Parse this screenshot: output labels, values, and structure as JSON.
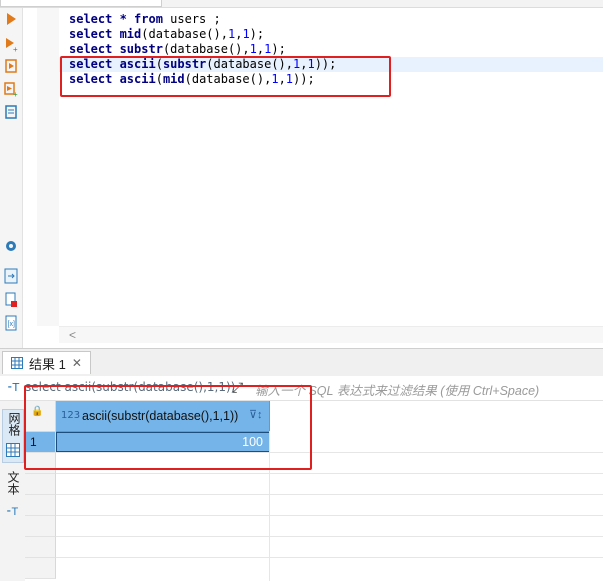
{
  "editor": {
    "lines": [
      {
        "parts": [
          {
            "t": "select * ",
            "c": "kw"
          },
          {
            "t": "from",
            "c": "kw"
          },
          {
            "t": " users ;",
            "c": ""
          }
        ]
      },
      {
        "parts": [
          {
            "t": "select ",
            "c": "kw"
          },
          {
            "t": "mid",
            "c": "kw"
          },
          {
            "t": "(database(),",
            "c": ""
          },
          {
            "t": "1",
            "c": "num"
          },
          {
            "t": ",",
            "c": ""
          },
          {
            "t": "1",
            "c": "num"
          },
          {
            "t": ");",
            "c": ""
          }
        ]
      },
      {
        "parts": [
          {
            "t": "select ",
            "c": "kw"
          },
          {
            "t": "substr",
            "c": "kw"
          },
          {
            "t": "(database(),",
            "c": ""
          },
          {
            "t": "1",
            "c": "num"
          },
          {
            "t": ",",
            "c": ""
          },
          {
            "t": "1",
            "c": "num"
          },
          {
            "t": ");",
            "c": ""
          }
        ]
      },
      {
        "parts": [
          {
            "t": "select ",
            "c": "kw"
          },
          {
            "t": "ascii",
            "c": "kw"
          },
          {
            "t": "(",
            "c": ""
          },
          {
            "t": "substr",
            "c": "kw"
          },
          {
            "t": "(database(),",
            "c": ""
          },
          {
            "t": "1",
            "c": "num"
          },
          {
            "t": ",",
            "c": ""
          },
          {
            "t": "1",
            "c": "num"
          },
          {
            "t": "));",
            "c": ""
          }
        ],
        "current": true
      },
      {
        "parts": [
          {
            "t": "select ",
            "c": "kw"
          },
          {
            "t": "ascii",
            "c": "kw"
          },
          {
            "t": "(",
            "c": ""
          },
          {
            "t": "mid",
            "c": "kw"
          },
          {
            "t": "(database(),",
            "c": ""
          },
          {
            "t": "1",
            "c": "num"
          },
          {
            "t": ",",
            "c": ""
          },
          {
            "t": "1",
            "c": "num"
          },
          {
            "t": "));",
            "c": ""
          }
        ]
      }
    ],
    "scroll_left_glyph": "<"
  },
  "results": {
    "tab_label": "结果 1",
    "tab_close": "✕",
    "filter": {
      "query_text": "select ascii(substr(database(),1,1))",
      "placeholder": "输入一个 SQL 表达式来过滤结果 (使用 Ctrl+Space)"
    },
    "side_tabs": {
      "grid": "网格",
      "text": "文本"
    },
    "column": {
      "type": "123",
      "name": "ascii(substr(database(),1,1))"
    },
    "rows": [
      {
        "num": "1",
        "value": "100"
      }
    ]
  },
  "colors": {
    "highlight_box": "#e02020",
    "selection": "#75b4e8",
    "keyword": "#000080",
    "number": "#0000ff"
  }
}
